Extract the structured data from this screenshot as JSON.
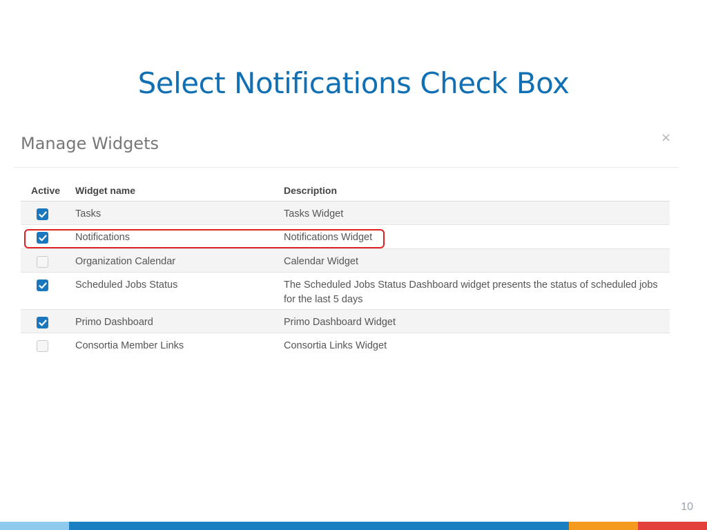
{
  "slide": {
    "title": "Select Notifications Check Box",
    "page_number": "10"
  },
  "dialog": {
    "title": "Manage Widgets",
    "close_icon": "×"
  },
  "table": {
    "headers": {
      "active": "Active",
      "name": "Widget name",
      "description": "Description"
    },
    "rows": [
      {
        "active": true,
        "name": "Tasks",
        "description": "Tasks Widget"
      },
      {
        "active": true,
        "name": "Notifications",
        "description": "Notifications Widget"
      },
      {
        "active": false,
        "name": "Organization Calendar",
        "description": "Calendar Widget"
      },
      {
        "active": true,
        "name": "Scheduled Jobs Status",
        "description": "The Scheduled Jobs Status Dashboard widget presents the status of scheduled jobs for the last 5 days"
      },
      {
        "active": true,
        "name": "Primo Dashboard",
        "description": "Primo Dashboard Widget"
      },
      {
        "active": false,
        "name": "Consortia Member Links",
        "description": "Consortia Links Widget"
      }
    ]
  },
  "colors": {
    "title": "#1170b4",
    "checkbox_on": "#1a77bd",
    "highlight": "#e02020",
    "footer": [
      "#8ec9ee",
      "#1a7fc1",
      "#f39a1f",
      "#e3403d"
    ]
  }
}
